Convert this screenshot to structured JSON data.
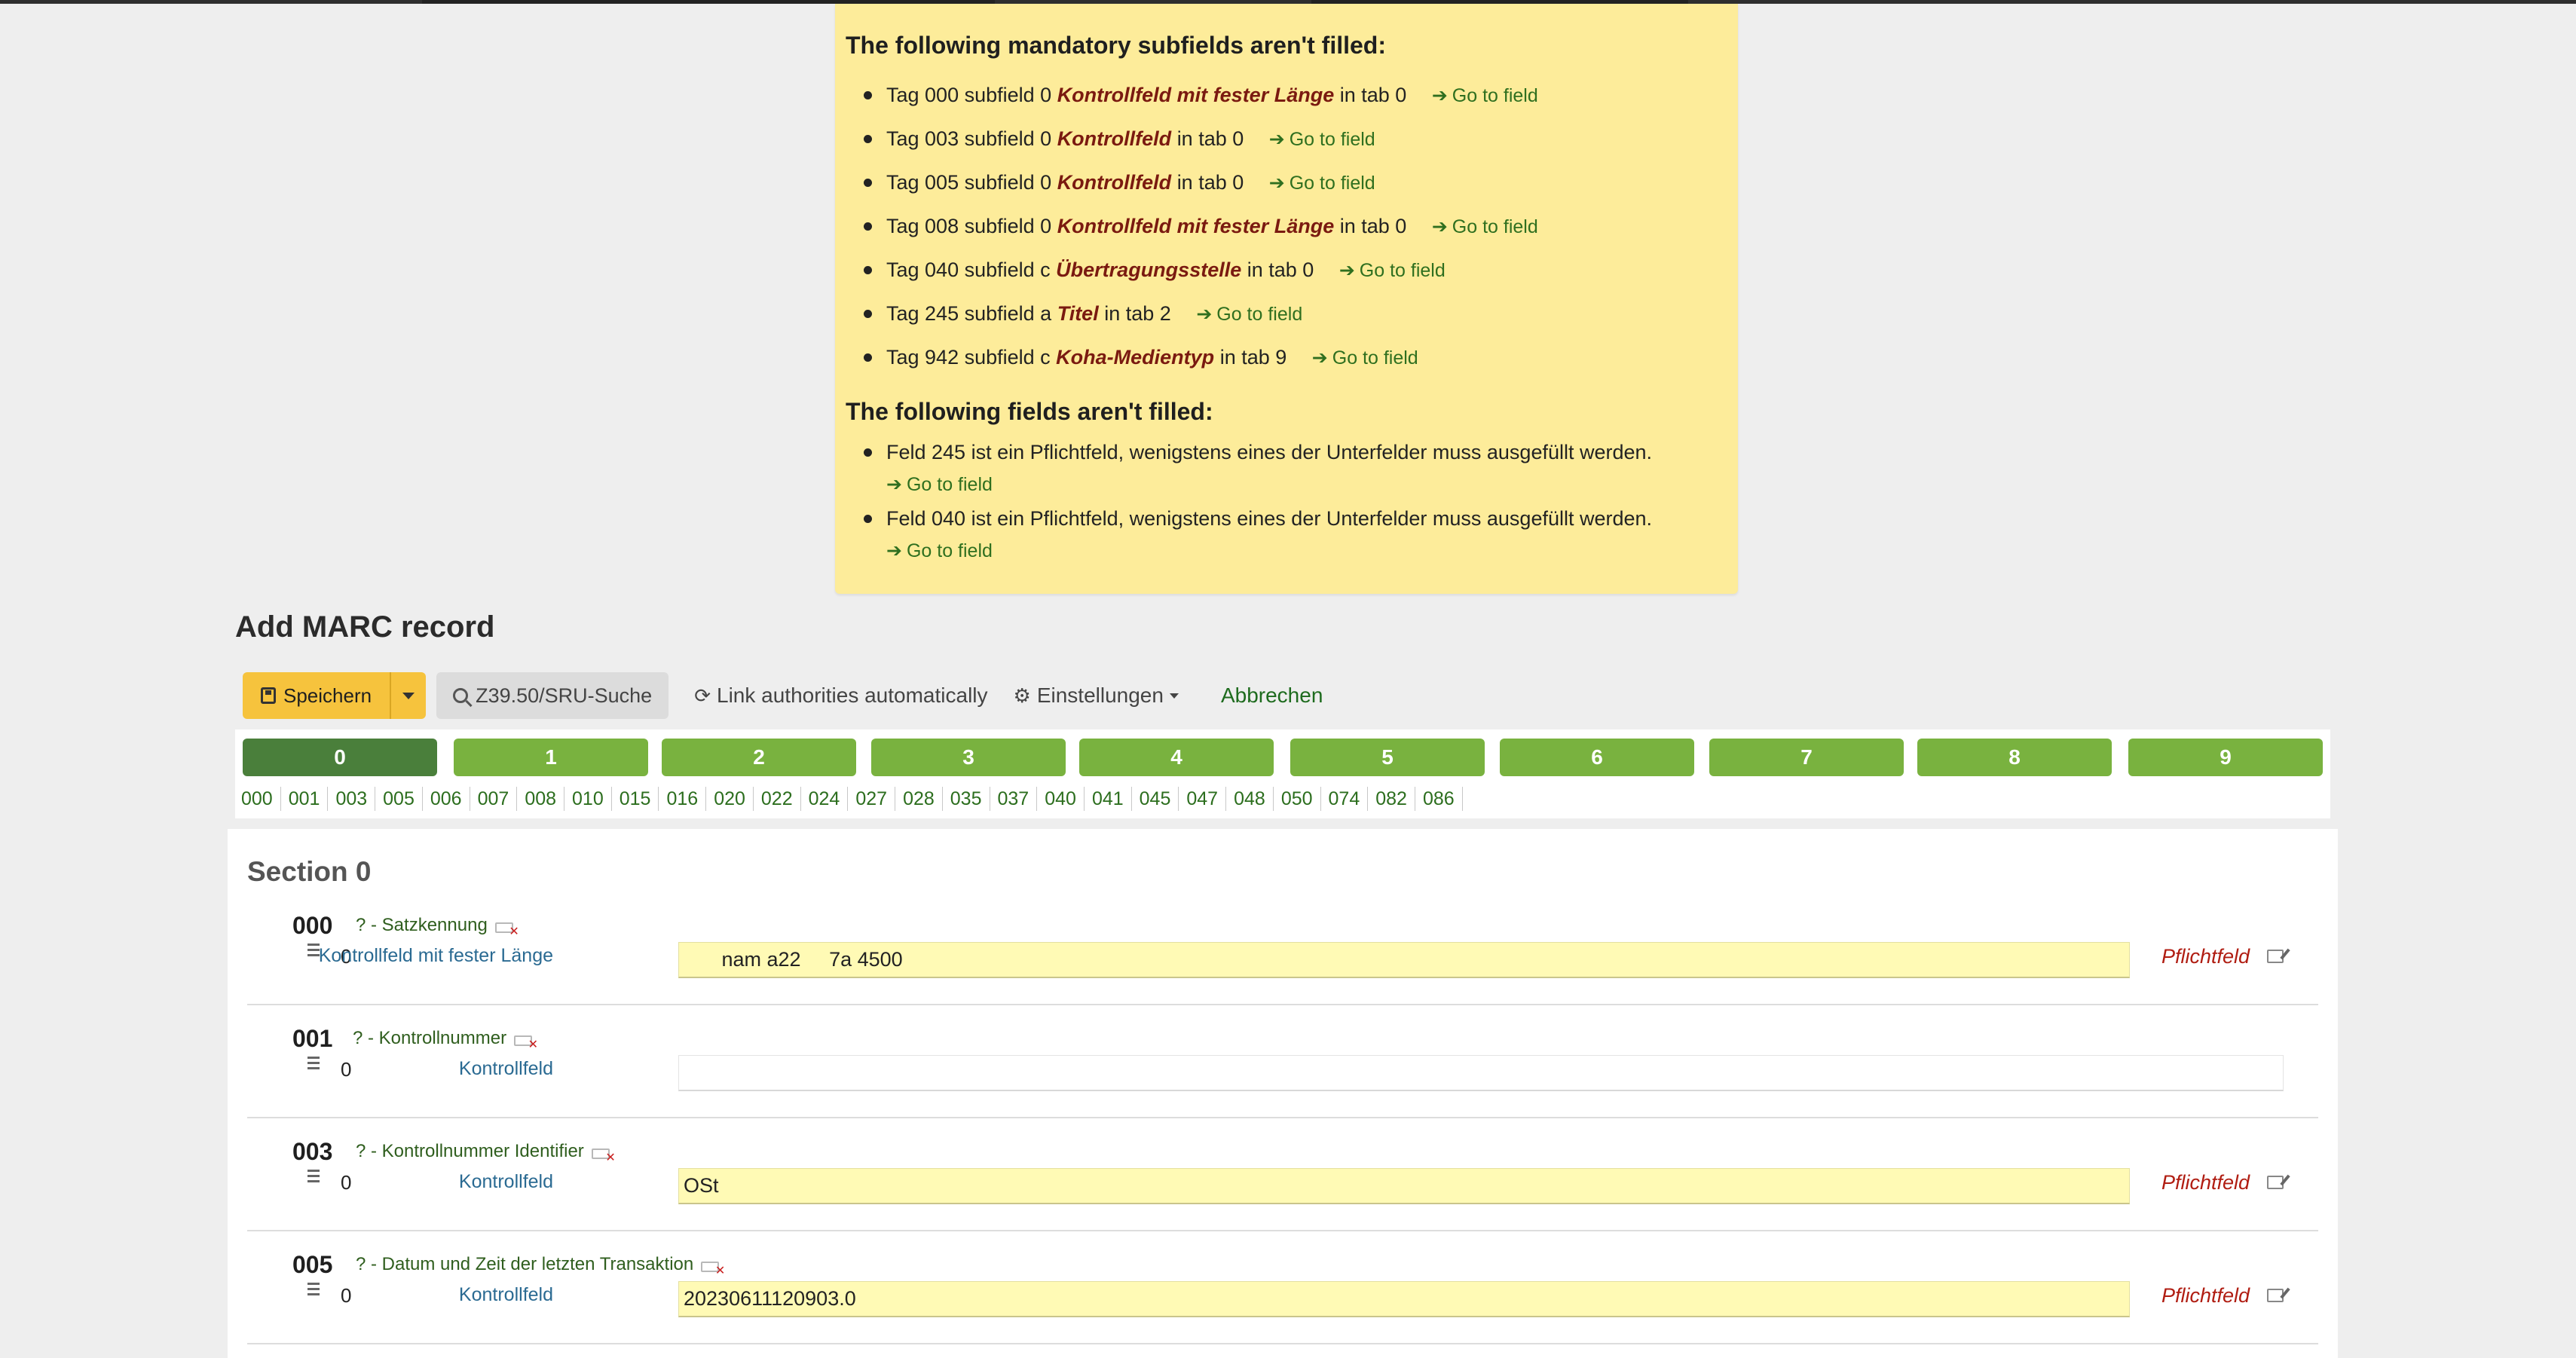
{
  "alert": {
    "subfields_heading": "The following mandatory subfields aren't filled:",
    "subfields": [
      {
        "prefix": "Tag 000 subfield 0",
        "name": "Kontrollfeld mit fester Länge",
        "suffix": "in tab 0"
      },
      {
        "prefix": "Tag 003 subfield 0",
        "name": "Kontrollfeld",
        "suffix": "in tab 0"
      },
      {
        "prefix": "Tag 005 subfield 0",
        "name": "Kontrollfeld",
        "suffix": "in tab 0"
      },
      {
        "prefix": "Tag 008 subfield 0",
        "name": "Kontrollfeld mit fester Länge",
        "suffix": "in tab 0"
      },
      {
        "prefix": "Tag 040 subfield c",
        "name": "Übertragungsstelle",
        "suffix": "in tab 0"
      },
      {
        "prefix": "Tag 245 subfield a",
        "name": "Titel",
        "suffix": "in tab 2"
      },
      {
        "prefix": "Tag 942 subfield c",
        "name": "Koha-Medientyp",
        "suffix": "in tab 9"
      }
    ],
    "fields_heading": "The following fields aren't filled:",
    "fields": [
      "Feld 245 ist ein Pflichtfeld, wenigstens eines der Unterfelder muss ausgefüllt werden.",
      "Feld 040 ist ein Pflichtfeld, wenigstens eines der Unterfelder muss ausgefüllt werden."
    ],
    "goto_label": "Go to field"
  },
  "page_title": "Add MARC record",
  "toolbar": {
    "save_label": "Speichern",
    "z3950_label": "Z39.50/SRU-Suche",
    "link_authorities_label": "Link authorities automatically",
    "settings_label": "Einstellungen",
    "cancel_label": "Abbrechen"
  },
  "tabs": [
    "0",
    "1",
    "2",
    "3",
    "4",
    "5",
    "6",
    "7",
    "8",
    "9"
  ],
  "active_tab": "0",
  "tag_links": [
    "000",
    "001",
    "003",
    "005",
    "006",
    "007",
    "008",
    "010",
    "015",
    "016",
    "020",
    "022",
    "024",
    "027",
    "028",
    "035",
    "037",
    "040",
    "041",
    "045",
    "047",
    "048",
    "050",
    "074",
    "082",
    "086"
  ],
  "section_title": "Section 0",
  "fields": [
    {
      "tag": "000",
      "description": "? - Satzkennung",
      "subfield": "0",
      "label": "Kontrollfeld mit fester Länge",
      "value": "   nam a22     7a 4500",
      "required": "Pflichtfeld"
    },
    {
      "tag": "001",
      "description": "? - Kontrollnummer",
      "subfield": "0",
      "label": "Kontrollfeld",
      "value": "",
      "required": ""
    },
    {
      "tag": "003",
      "description": "? - Kontrollnummer Identifier",
      "subfield": "0",
      "label": "Kontrollfeld",
      "value": "OSt",
      "required": "Pflichtfeld"
    },
    {
      "tag": "005",
      "description": "? - Datum und Zeit der letzten Transaktion",
      "subfield": "0",
      "label": "Kontrollfeld",
      "value": "20230611120903.0",
      "required": "Pflichtfeld"
    }
  ],
  "colors": {
    "alert_bg": "#fdec9a",
    "tab_green": "#79b23f",
    "tab_active": "#4a7f3b",
    "save_yellow": "#f6c33d",
    "required_red": "#b01d12",
    "input_yellow": "#fffab5"
  }
}
